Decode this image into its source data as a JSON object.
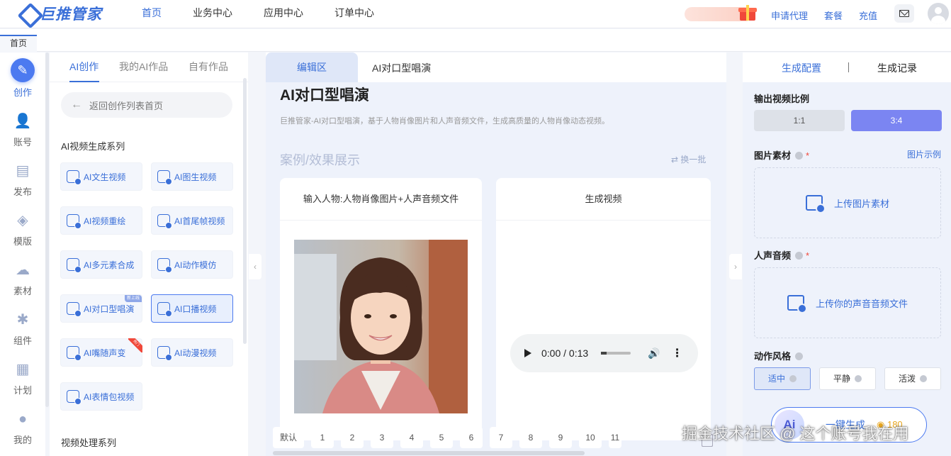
{
  "app": {
    "brand": "巨推管家",
    "brand_color": "#3a6fd8"
  },
  "nav": {
    "items": [
      "首页",
      "业务中心",
      "应用中心",
      "订单中心"
    ]
  },
  "header_links": {
    "agent": "申请代理",
    "plan": "套餐",
    "recharge": "充值"
  },
  "page_tab": "首页",
  "rail": [
    {
      "label": "创作",
      "icon": "pencil-icon"
    },
    {
      "label": "账号",
      "icon": "user-add-icon"
    },
    {
      "label": "发布",
      "icon": "publish-icon"
    },
    {
      "label": "模版",
      "icon": "layers-icon"
    },
    {
      "label": "素材",
      "icon": "cloud-upload-icon"
    },
    {
      "label": "组件",
      "icon": "puzzle-icon"
    },
    {
      "label": "计划",
      "icon": "calendar-icon"
    },
    {
      "label": "我的",
      "icon": "person-icon"
    }
  ],
  "create_panel": {
    "tabs": [
      "AI创作",
      "我的AI作品",
      "自有作品"
    ],
    "back": "返回创作列表首页",
    "section_video": "AI视频生成系列",
    "features": [
      "AI文生视频",
      "AI图生视频",
      "AI视频重绘",
      "AI首尾帧视频",
      "AI多元素合成",
      "AI动作模仿",
      "AI对口型唱演",
      "AI口播视频",
      "AI嘴随声变",
      "AI动漫视频",
      "AI表情包视频"
    ],
    "badge_new": "新上线",
    "badge_hot": "热门",
    "section_process": "视频处理系列"
  },
  "editor": {
    "tab_active": "编辑区",
    "tab_name": "AI对口型唱演",
    "title": "AI对口型唱演",
    "description": "巨推管家-AI对口型唱演，基于人物肖像图片和人声音频文件，生成高质量的人物肖像动态视频。",
    "section": "案例/效果展示",
    "refresh": "换一批",
    "card_input": "输入人物:人物肖像图片+人声音频文件",
    "card_output": "生成视频",
    "audio_time": "0:00 / 0:13",
    "pages": [
      "默认",
      "1",
      "2",
      "3",
      "4",
      "5",
      "6",
      "7",
      "8",
      "9",
      "10",
      "11"
    ]
  },
  "config": {
    "tab_config": "生成配置",
    "tab_records": "生成记录",
    "ratio_label": "输出视频比例",
    "ratios": [
      "1:1",
      "3:4"
    ],
    "image_label": "图片素材",
    "image_example": "图片示例",
    "upload_image": "上传图片素材",
    "audio_label": "人声音频",
    "upload_audio": "上传你的声音音频文件",
    "style_label": "动作风格",
    "styles": [
      "适中",
      "平静",
      "活泼"
    ],
    "generate": "一键生成",
    "cost": "180",
    "required": "*"
  },
  "watermark": "掘金技术社区 @ 这个账号我在用"
}
